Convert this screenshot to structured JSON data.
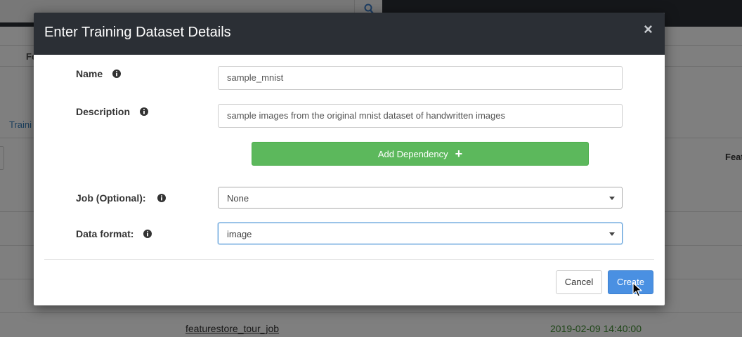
{
  "background": {
    "header_label": "Fe",
    "tab_label": "Traini",
    "right_label": "Feat",
    "job_link": "featurestore_tour_job",
    "job_timestamp": "2019-02-09 14:40:00",
    "search_icon": "search-icon"
  },
  "modal": {
    "title": "Enter Training Dataset Details",
    "close_label": "×",
    "fields": {
      "name": {
        "label": "Name",
        "value": "sample_mnist"
      },
      "description": {
        "label": "Description",
        "value": "sample images from the original mnist dataset of handwritten images"
      },
      "job": {
        "label": "Job (Optional):",
        "selected": "None"
      },
      "data_format": {
        "label": "Data format:",
        "selected": "image"
      }
    },
    "add_dependency_label": "Add Dependency",
    "add_dependency_icon": "+",
    "cancel_label": "Cancel",
    "create_label": "Create"
  },
  "colors": {
    "header_bg": "#2b2f35",
    "success": "#5cb85c",
    "primary": "#4a90e2",
    "timestamp_green": "#3c8a2e"
  }
}
